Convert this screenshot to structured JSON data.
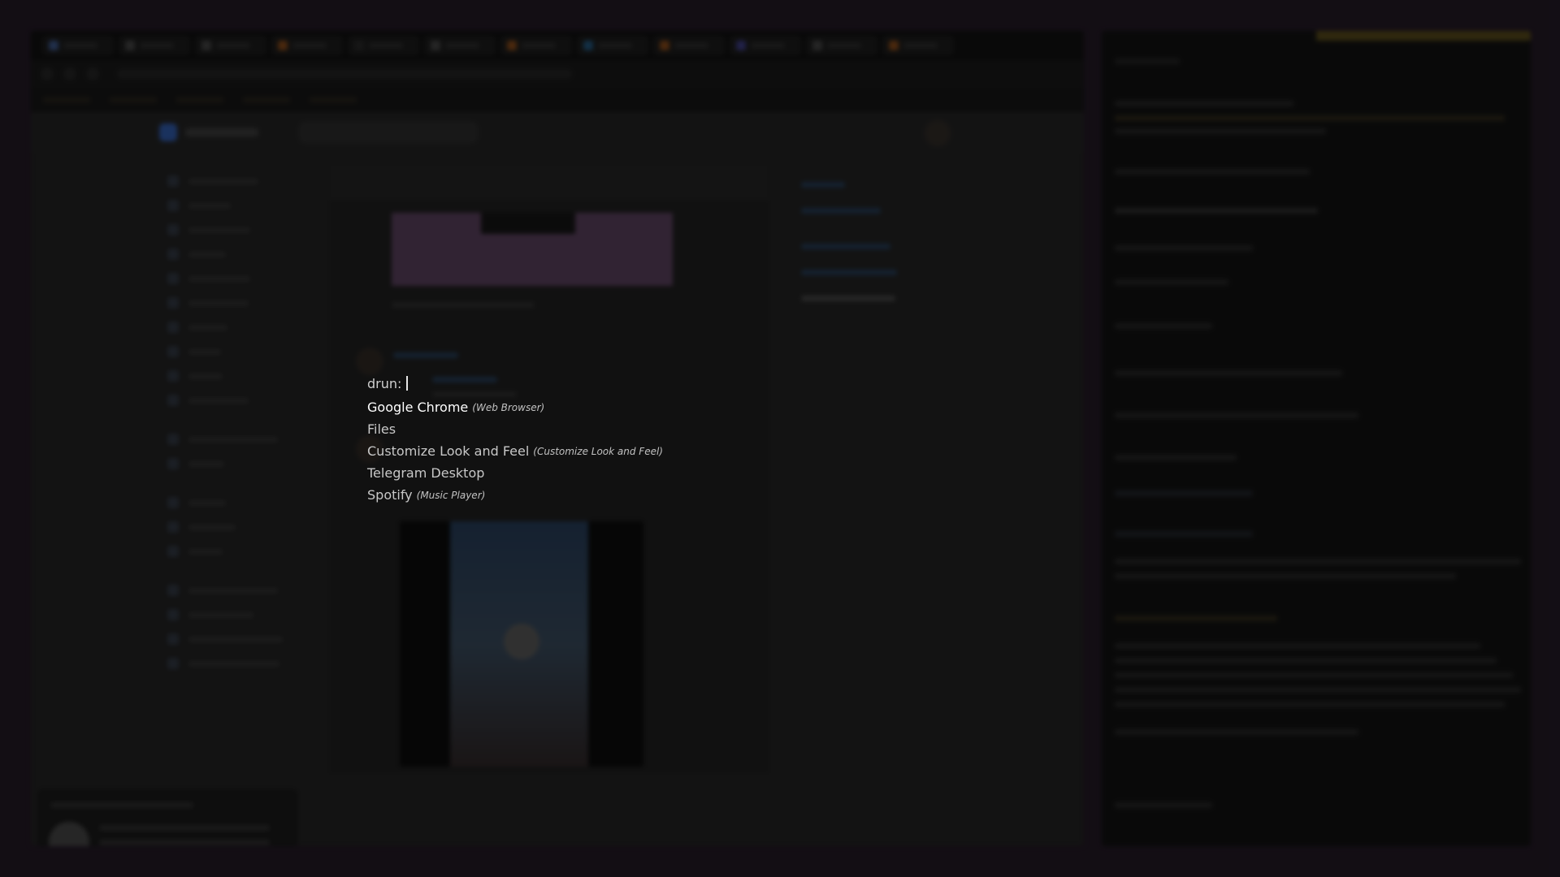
{
  "launcher": {
    "prompt": "drun:",
    "query": "",
    "entries": [
      {
        "name": "Google Chrome",
        "generic": "(Web Browser)",
        "selected": true
      },
      {
        "name": "Files",
        "generic": "",
        "selected": false
      },
      {
        "name": "Customize Look and Feel",
        "generic": "(Customize Look and Feel)",
        "selected": false
      },
      {
        "name": "Telegram Desktop",
        "generic": "",
        "selected": false
      },
      {
        "name": "Spotify",
        "generic": "(Music Player)",
        "selected": false
      }
    ]
  },
  "background": {
    "browser_window_description_visible": false,
    "accent_colors": {
      "desktop": "#2b1f2e",
      "vk_blue": "#3b6fd1",
      "media_pink": "#6e4f72",
      "terminal_yellow": "#6a5a20"
    }
  }
}
